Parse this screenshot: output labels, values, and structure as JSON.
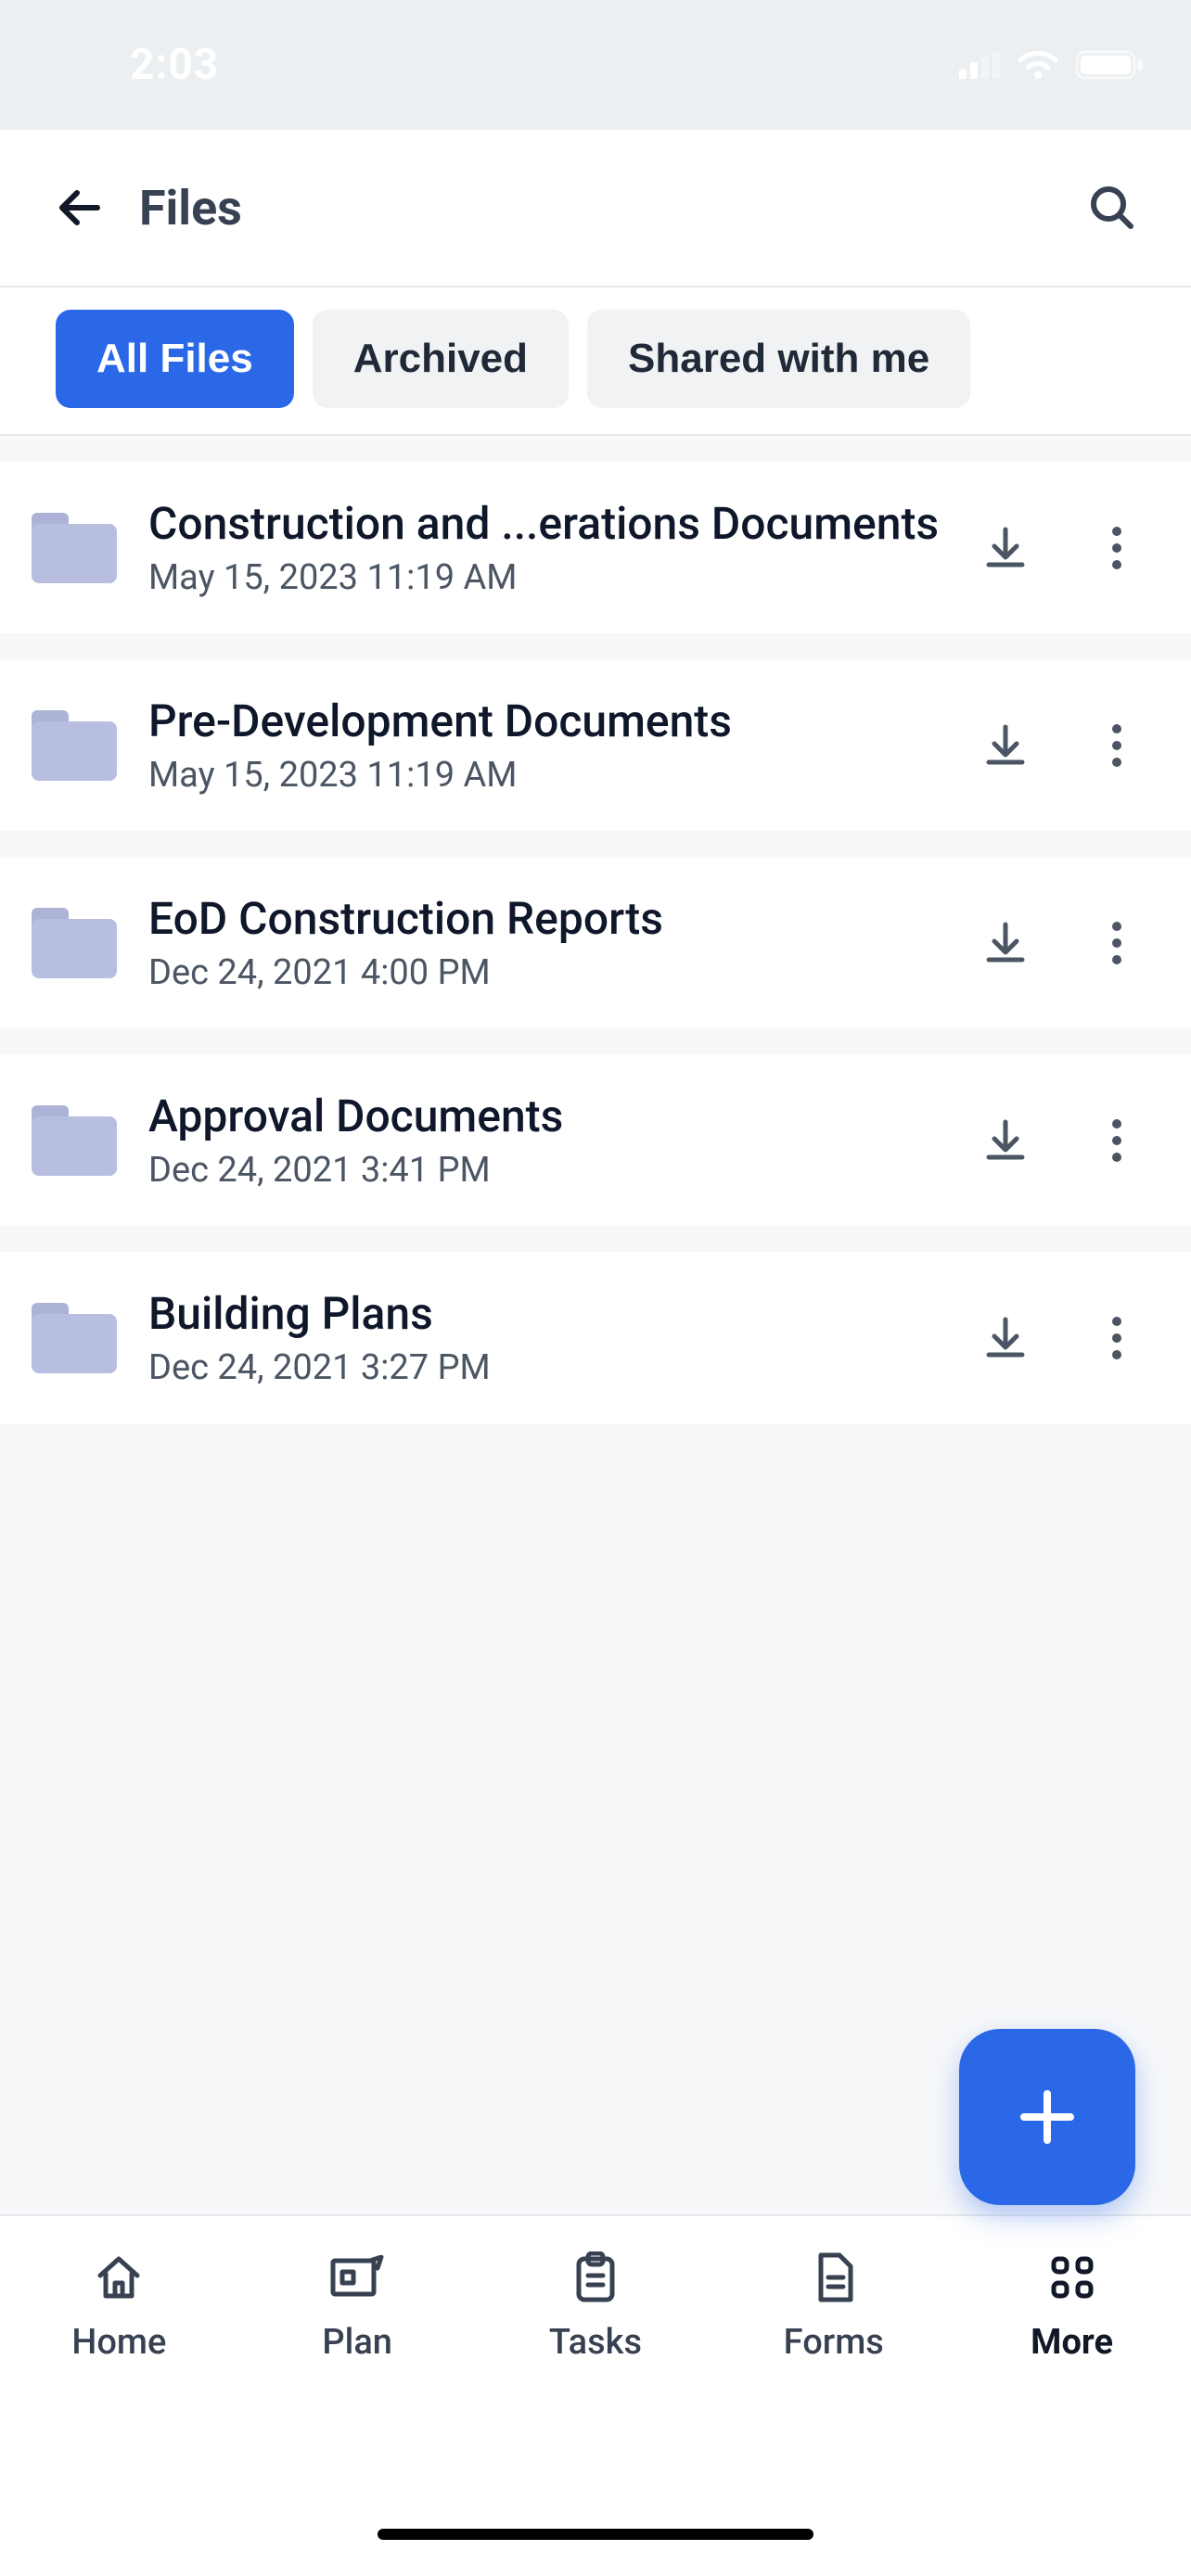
{
  "status": {
    "time": "2:03"
  },
  "header": {
    "title": "Files"
  },
  "filters": {
    "tabs": [
      {
        "label": "All Files",
        "active": true
      },
      {
        "label": "Archived",
        "active": false
      },
      {
        "label": "Shared with me",
        "active": false
      }
    ]
  },
  "files": [
    {
      "name": "Construction and ...erations Documents",
      "date": "May 15, 2023 11:19 AM"
    },
    {
      "name": "Pre-Development Documents",
      "date": "May 15, 2023 11:19 AM"
    },
    {
      "name": "EoD Construction Reports",
      "date": "Dec 24, 2021 4:00 PM"
    },
    {
      "name": "Approval Documents",
      "date": "Dec 24, 2021 3:41 PM"
    },
    {
      "name": "Building Plans",
      "date": "Dec 24, 2021 3:27 PM"
    }
  ],
  "nav": {
    "items": [
      {
        "label": "Home",
        "icon": "home",
        "active": false
      },
      {
        "label": "Plan",
        "icon": "plan",
        "active": false
      },
      {
        "label": "Tasks",
        "icon": "tasks",
        "active": false
      },
      {
        "label": "Forms",
        "icon": "forms",
        "active": false
      },
      {
        "label": "More",
        "icon": "more",
        "active": true
      }
    ]
  }
}
